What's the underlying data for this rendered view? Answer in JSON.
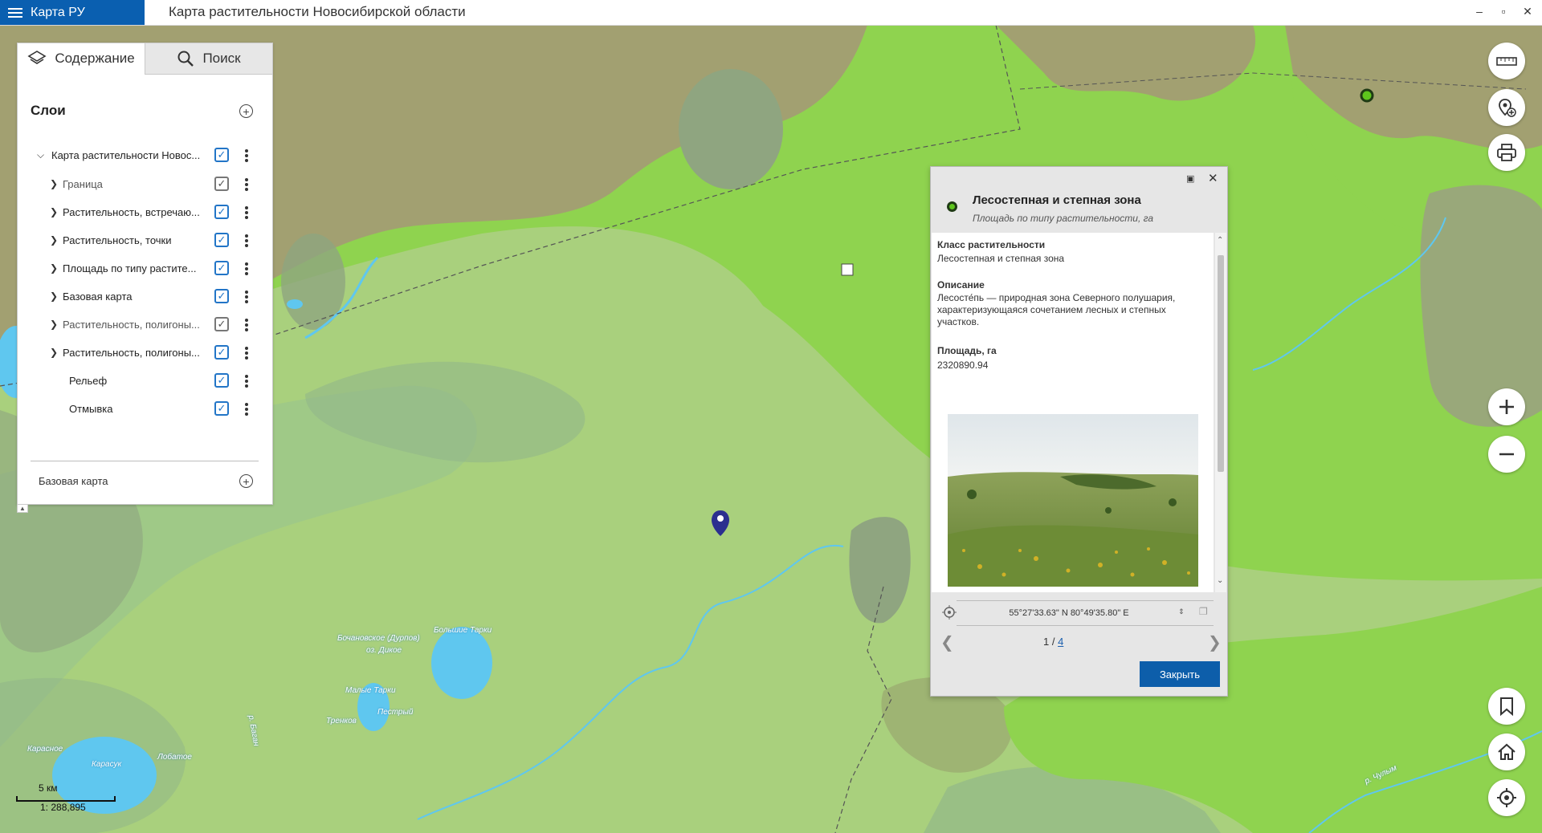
{
  "app": {
    "menu_label": "Карта РУ",
    "window_title": "Карта растительности Новосибирской области",
    "controls": [
      "‒",
      "▫",
      "✕"
    ]
  },
  "sidebar": {
    "tabs": [
      {
        "label": "Содержание",
        "icon": "layers-icon",
        "active": true
      },
      {
        "label": "Поиск",
        "icon": "search-icon",
        "active": false
      }
    ],
    "layers_heading": "Слои",
    "layers": [
      {
        "label": "Карта растительности Новос...",
        "checked": true,
        "expanded": true,
        "level": 0,
        "dim": false
      },
      {
        "label": "Граница",
        "checked": true,
        "level": 1,
        "dim": true
      },
      {
        "label": "Растительность, встречаю...",
        "checked": true,
        "level": 1,
        "dim": false
      },
      {
        "label": "Растительность, точки",
        "checked": true,
        "level": 1,
        "dim": false
      },
      {
        "label": "Площадь по типу растите...",
        "checked": true,
        "level": 1,
        "dim": false
      },
      {
        "label": "Базовая карта",
        "checked": true,
        "level": 1,
        "dim": false
      },
      {
        "label": "Растительность, полигоны...",
        "checked": true,
        "level": 1,
        "dim": true
      },
      {
        "label": "Растительность, полигоны...",
        "checked": true,
        "level": 1,
        "dim": false
      },
      {
        "label": "Рельеф",
        "checked": true,
        "level": 2,
        "dim": false
      },
      {
        "label": "Отмывка",
        "checked": true,
        "level": 2,
        "dim": false
      }
    ],
    "basemap_label": "Базовая карта"
  },
  "popup": {
    "title": "Лесостепная и степная зона",
    "subtitle": "Площадь по типу растительности, га",
    "fields": [
      {
        "name": "Класс растительности",
        "value": "Лесостепная и степная зона"
      },
      {
        "name": "Описание",
        "value": "Лесосте́пь — природная зона Северного полушария, характеризующаяся сочетанием лесных и степных участков."
      },
      {
        "name": "Площадь, га",
        "value": "2320890.94"
      }
    ],
    "coordinates": "55°27'33.63\" N 80°49'35.80\" E",
    "pager_current": "1 /",
    "pager_total": "4",
    "close_label": "Закрыть"
  },
  "map": {
    "labels": [
      {
        "text": "Большие Тарки"
      },
      {
        "text": "Бочановское (Дурпов)"
      },
      {
        "text": "оз. Дикое"
      },
      {
        "text": "Малые Тарки"
      },
      {
        "text": "Пестрый"
      },
      {
        "text": "Тренков"
      },
      {
        "text": "Карасук"
      },
      {
        "text": "Карасное"
      },
      {
        "text": "Лобатое"
      },
      {
        "text": "р. Баган"
      },
      {
        "text": "р. Чулым"
      }
    ],
    "scale_label": "5 км",
    "scale_ratio": "1: 288,895"
  },
  "tools": [
    "ruler-icon",
    "location-pin-icon",
    "print-icon",
    "zoom-in-icon",
    "zoom-out-icon",
    "bookmark-icon",
    "home-icon",
    "locate-icon"
  ],
  "colors": {
    "bright_green": "#8fd34f",
    "light_green": "#a9d07d",
    "olive": "#a2a071",
    "grey_green": "#8fa580",
    "water": "#5fc7ef",
    "accent_blue": "#0d5eaa"
  }
}
